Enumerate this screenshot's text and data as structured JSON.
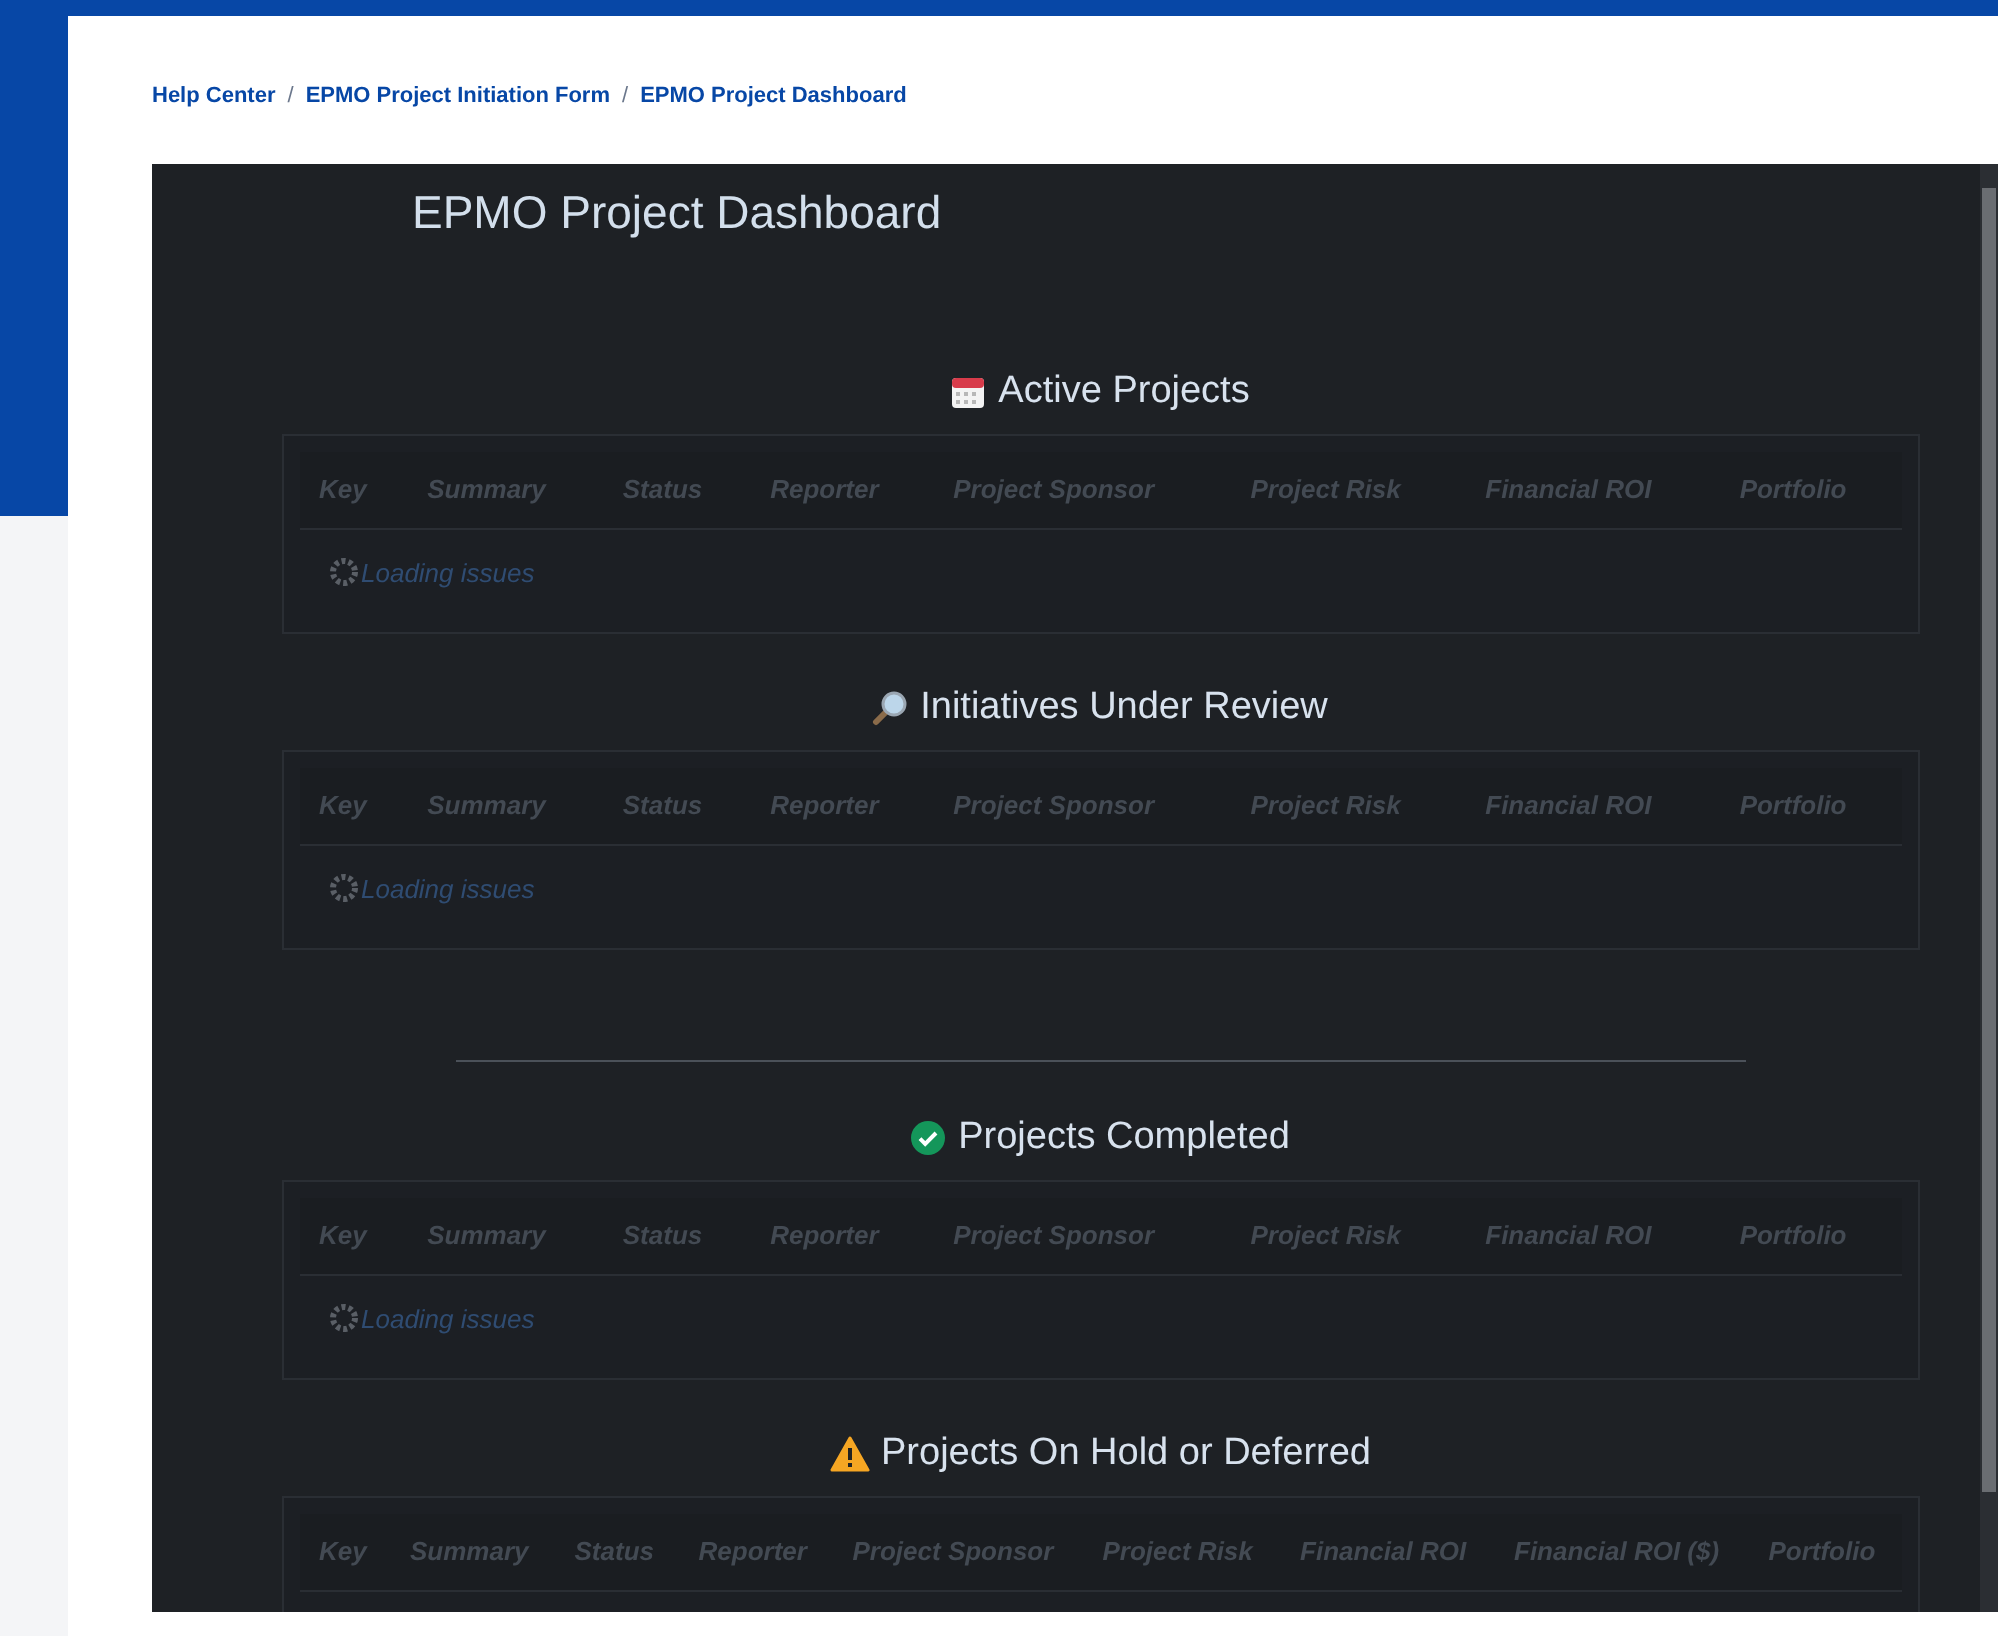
{
  "breadcrumbs": [
    {
      "label": "Help Center"
    },
    {
      "label": "EPMO Project Initiation Form"
    },
    {
      "label": "EPMO Project Dashboard"
    }
  ],
  "separator": "/",
  "dashboard": {
    "title": "EPMO Project Dashboard",
    "sections": [
      {
        "kind": "calendar",
        "title": "Active Projects",
        "divider_before": false,
        "columns": [
          "Key",
          "Summary",
          "Status",
          "Reporter",
          "Project Sponsor",
          "Project Risk",
          "Financial ROI",
          "Portfolio"
        ],
        "loading": "Loading issues"
      },
      {
        "kind": "magnifier",
        "title": "Initiatives Under Review",
        "divider_before": false,
        "columns": [
          "Key",
          "Summary",
          "Status",
          "Reporter",
          "Project Sponsor",
          "Project Risk",
          "Financial ROI",
          "Portfolio"
        ],
        "loading": "Loading issues"
      },
      {
        "kind": "check",
        "title": "Projects Completed",
        "divider_before": true,
        "columns": [
          "Key",
          "Summary",
          "Status",
          "Reporter",
          "Project Sponsor",
          "Project Risk",
          "Financial ROI",
          "Portfolio"
        ],
        "loading": "Loading issues"
      },
      {
        "kind": "warning",
        "title": "Projects On Hold or Deferred",
        "divider_before": false,
        "columns": [
          "Key",
          "Summary",
          "Status",
          "Reporter",
          "Project Sponsor",
          "Project Risk",
          "Financial ROI",
          "Financial ROI ($)",
          "Portfolio"
        ]
      }
    ]
  }
}
